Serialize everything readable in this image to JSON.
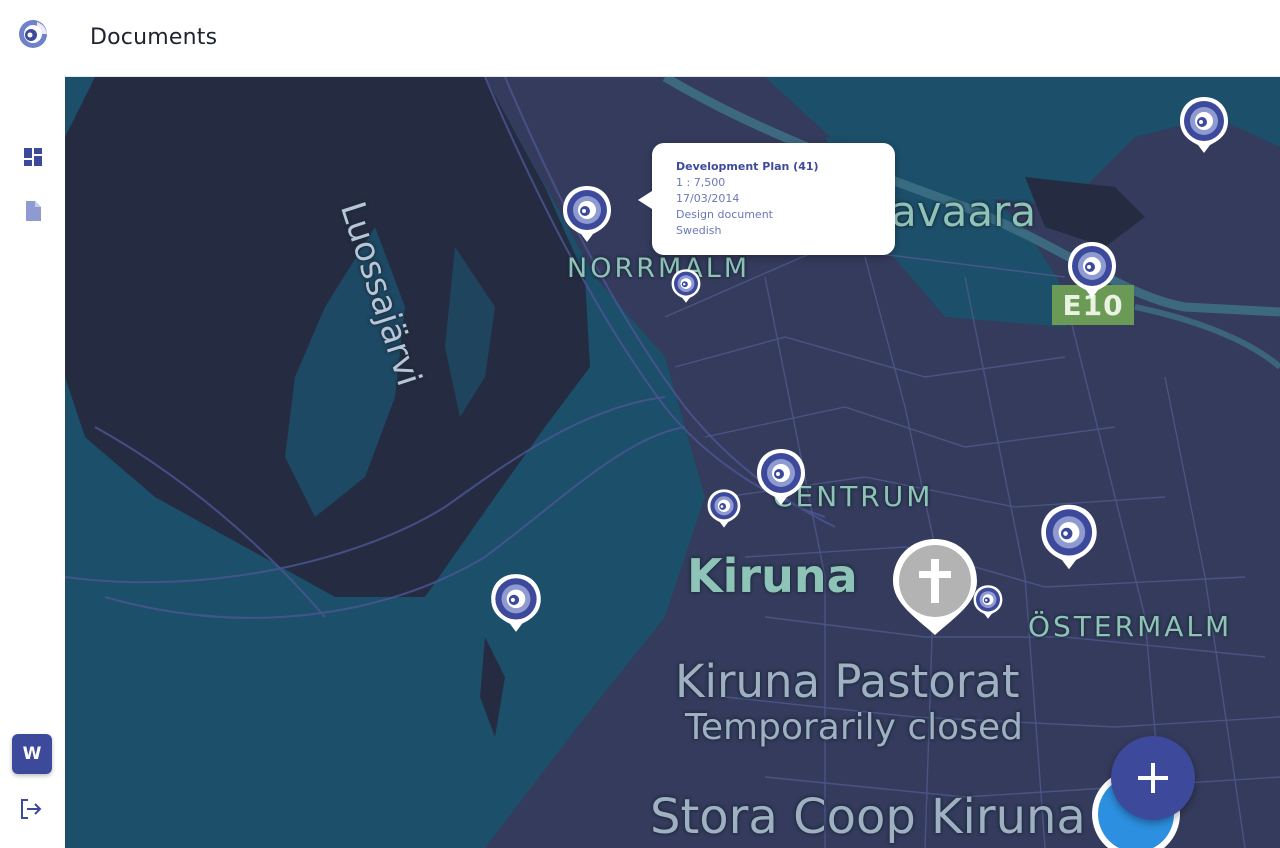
{
  "header": {
    "title": "Documents"
  },
  "sidebar": {
    "items": [
      {
        "name": "dashboard",
        "icon": "dashboard-icon"
      },
      {
        "name": "documents",
        "icon": "document-icon"
      }
    ],
    "user_initial": "W",
    "logout_icon": "logout-icon"
  },
  "map": {
    "labels": {
      "lake": "Luossajärvi",
      "norrmalm": "NORRMALM",
      "vavaara": "avaara",
      "centrum": "CENTRUM",
      "kiruna": "Kiruna",
      "ostermalm": "ÖSTERMALM",
      "pastorat": "Kiruna Pastorat",
      "closed": "Temporarily closed",
      "coop": "Stora Coop Kiruna",
      "road": "E10"
    },
    "popup": {
      "title": "Development Plan (41)",
      "scale": "1 : 7,500",
      "date": "17/03/2014",
      "type": "Design document",
      "language": "Swedish"
    }
  },
  "colors": {
    "accent": "#3d4a9c",
    "map_water": "#1c4f6a",
    "map_land": "#343b5c",
    "map_label": "#8ec3b8"
  },
  "fab": {
    "icon": "plus-icon"
  }
}
